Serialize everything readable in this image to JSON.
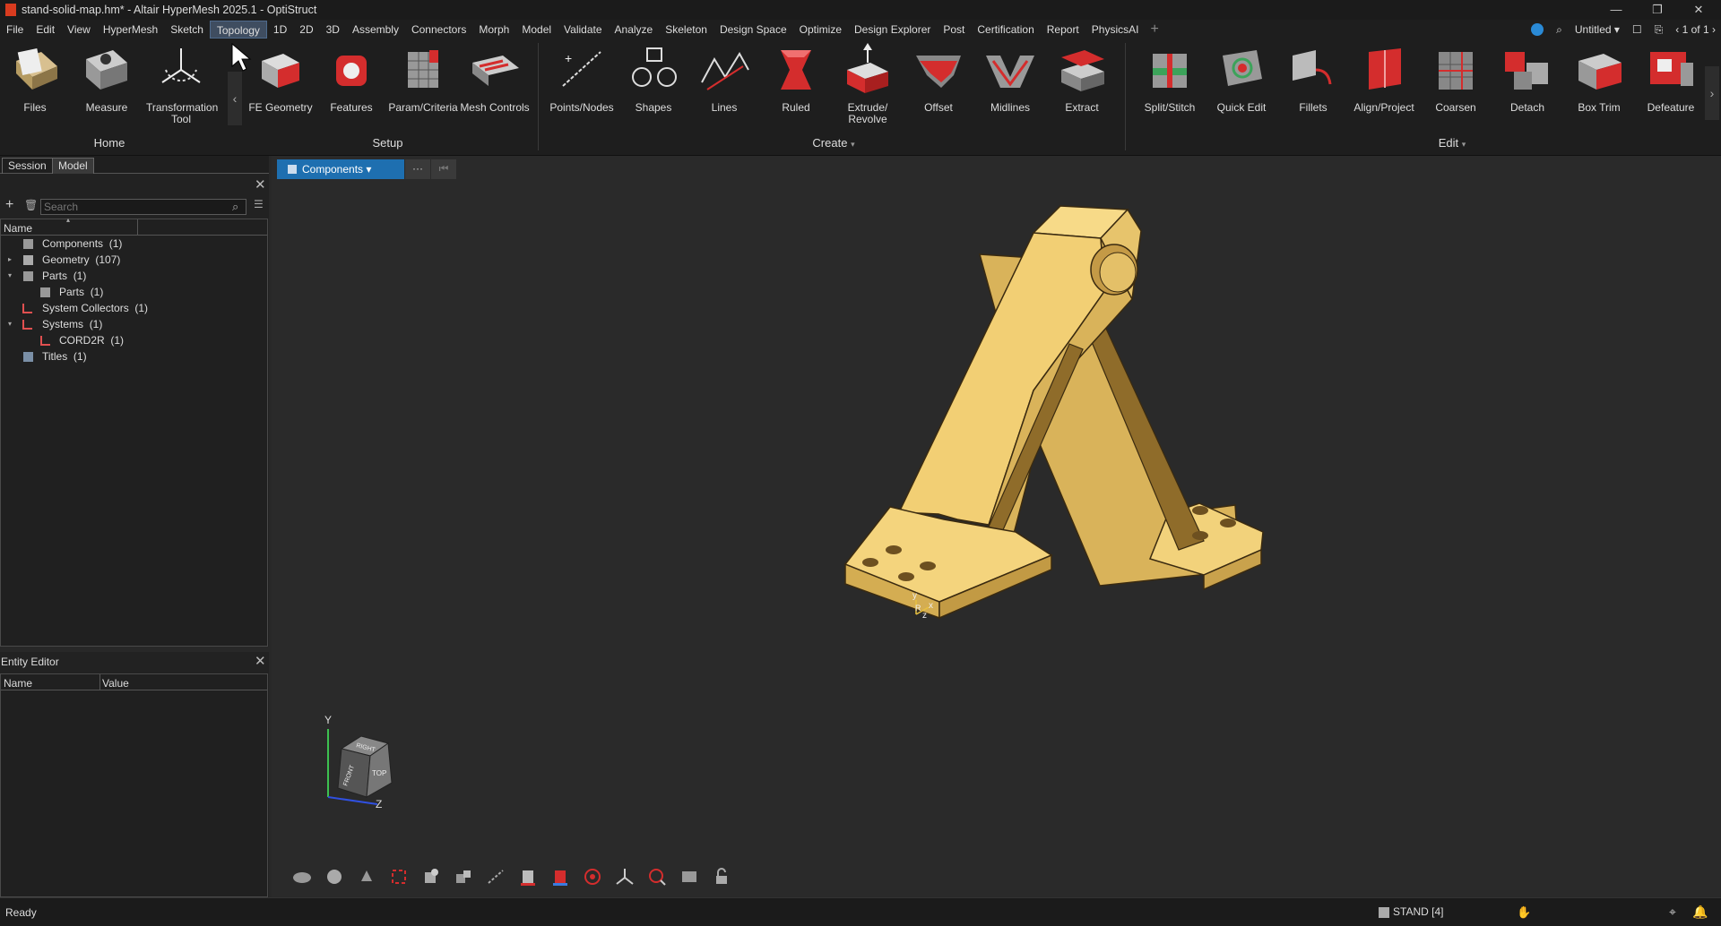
{
  "window": {
    "title": "stand-solid-map.hm* - Altair HyperMesh 2025.1 - OptiStruct"
  },
  "menu": [
    "File",
    "Edit",
    "View",
    "HyperMesh",
    "Sketch",
    "Topology",
    "1D",
    "2D",
    "3D",
    "Assembly",
    "Connectors",
    "Morph",
    "Model",
    "Validate",
    "Analyze",
    "Skeleton",
    "Design Space",
    "Optimize",
    "Design Explorer",
    "Post",
    "Certification",
    "Report",
    "PhysicsAI"
  ],
  "menu_active": "Topology",
  "menu_right": {
    "workspace": "Untitled",
    "page": "1 of 1"
  },
  "ribbon": {
    "tools": [
      "Files",
      "Measure",
      "Transformation Tool",
      "FE Geometry",
      "Features",
      "Param/Criteria",
      "Mesh Controls",
      "Points/Nodes",
      "Shapes",
      "Lines",
      "Ruled",
      "Extrude/ Revolve",
      "Offset",
      "Midlines",
      "Extract",
      "Split/Stitch",
      "Quick Edit",
      "Fillets",
      "Align/Project",
      "Coarsen",
      "Detach",
      "Box Trim",
      "Defeature"
    ],
    "groups": [
      "Home",
      "Setup",
      "Create",
      "Edit"
    ]
  },
  "panel_tabs": [
    "Session",
    "Model"
  ],
  "browser": {
    "search_placeholder": "Search",
    "col_name": "Name",
    "tree": [
      {
        "label": "Components",
        "count": "(1)"
      },
      {
        "label": "Geometry",
        "count": "(107)"
      },
      {
        "label": "Parts",
        "count": "(1)"
      },
      {
        "label": "Parts",
        "count": "(1)"
      },
      {
        "label": "System Collectors",
        "count": "(1)"
      },
      {
        "label": "Systems",
        "count": "(1)"
      },
      {
        "label": "CORD2R",
        "count": "(1)"
      },
      {
        "label": "Titles",
        "count": "(1)"
      }
    ]
  },
  "entity_editor": {
    "title": "Entity Editor",
    "col_name": "Name",
    "col_value": "Value"
  },
  "viewport": {
    "components_label": "Components",
    "more_label": "···",
    "triad": {
      "y": "Y",
      "z": "Z",
      "top": "TOP",
      "front": "FRONT",
      "right": "RIGHT"
    },
    "origin": {
      "y": "y",
      "x": "x",
      "z": "z",
      "r": "R"
    }
  },
  "status": {
    "left": "Ready",
    "component": "STAND [4]"
  },
  "colors": {
    "part": "#f0cc6c",
    "accent": "#1e6fb0",
    "red": "#d42d2d"
  }
}
